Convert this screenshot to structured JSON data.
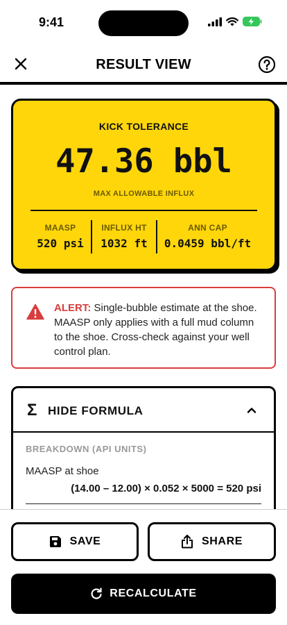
{
  "status_bar": {
    "time": "9:41"
  },
  "header": {
    "title": "RESULT VIEW"
  },
  "result": {
    "heading": "KICK TOLERANCE",
    "value": "47.36 bbl",
    "caption": "MAX ALLOWABLE INFLUX",
    "metrics": [
      {
        "label": "MAASP",
        "value": "520 psi"
      },
      {
        "label": "INFLUX HT",
        "value": "1032 ft"
      },
      {
        "label": "ANN CAP",
        "value": "0.0459 bbl/ft"
      }
    ],
    "colors": {
      "card_bg": "#ffd60a",
      "caption": "#6b5a00"
    }
  },
  "alert": {
    "label": "ALERT:",
    "text": " Single-bubble estimate at the shoe. MAASP only applies with a full mud column to the shoe. Cross-check against your well control plan.",
    "icon": "warning-triangle-icon",
    "color": "#d93c3c"
  },
  "formula": {
    "symbol": "Σ",
    "toggle_label": "HIDE FORMULA",
    "breakdown_label": "BREAKDOWN (API UNITS)",
    "rows": [
      {
        "label": "MAASP at shoe",
        "equation": "(14.00 – 12.00) × 0.052 × 5000 = 520 psi"
      }
    ]
  },
  "actions": {
    "save_label": "SAVE",
    "share_label": "SHARE",
    "recalculate_label": "RECALCULATE"
  }
}
